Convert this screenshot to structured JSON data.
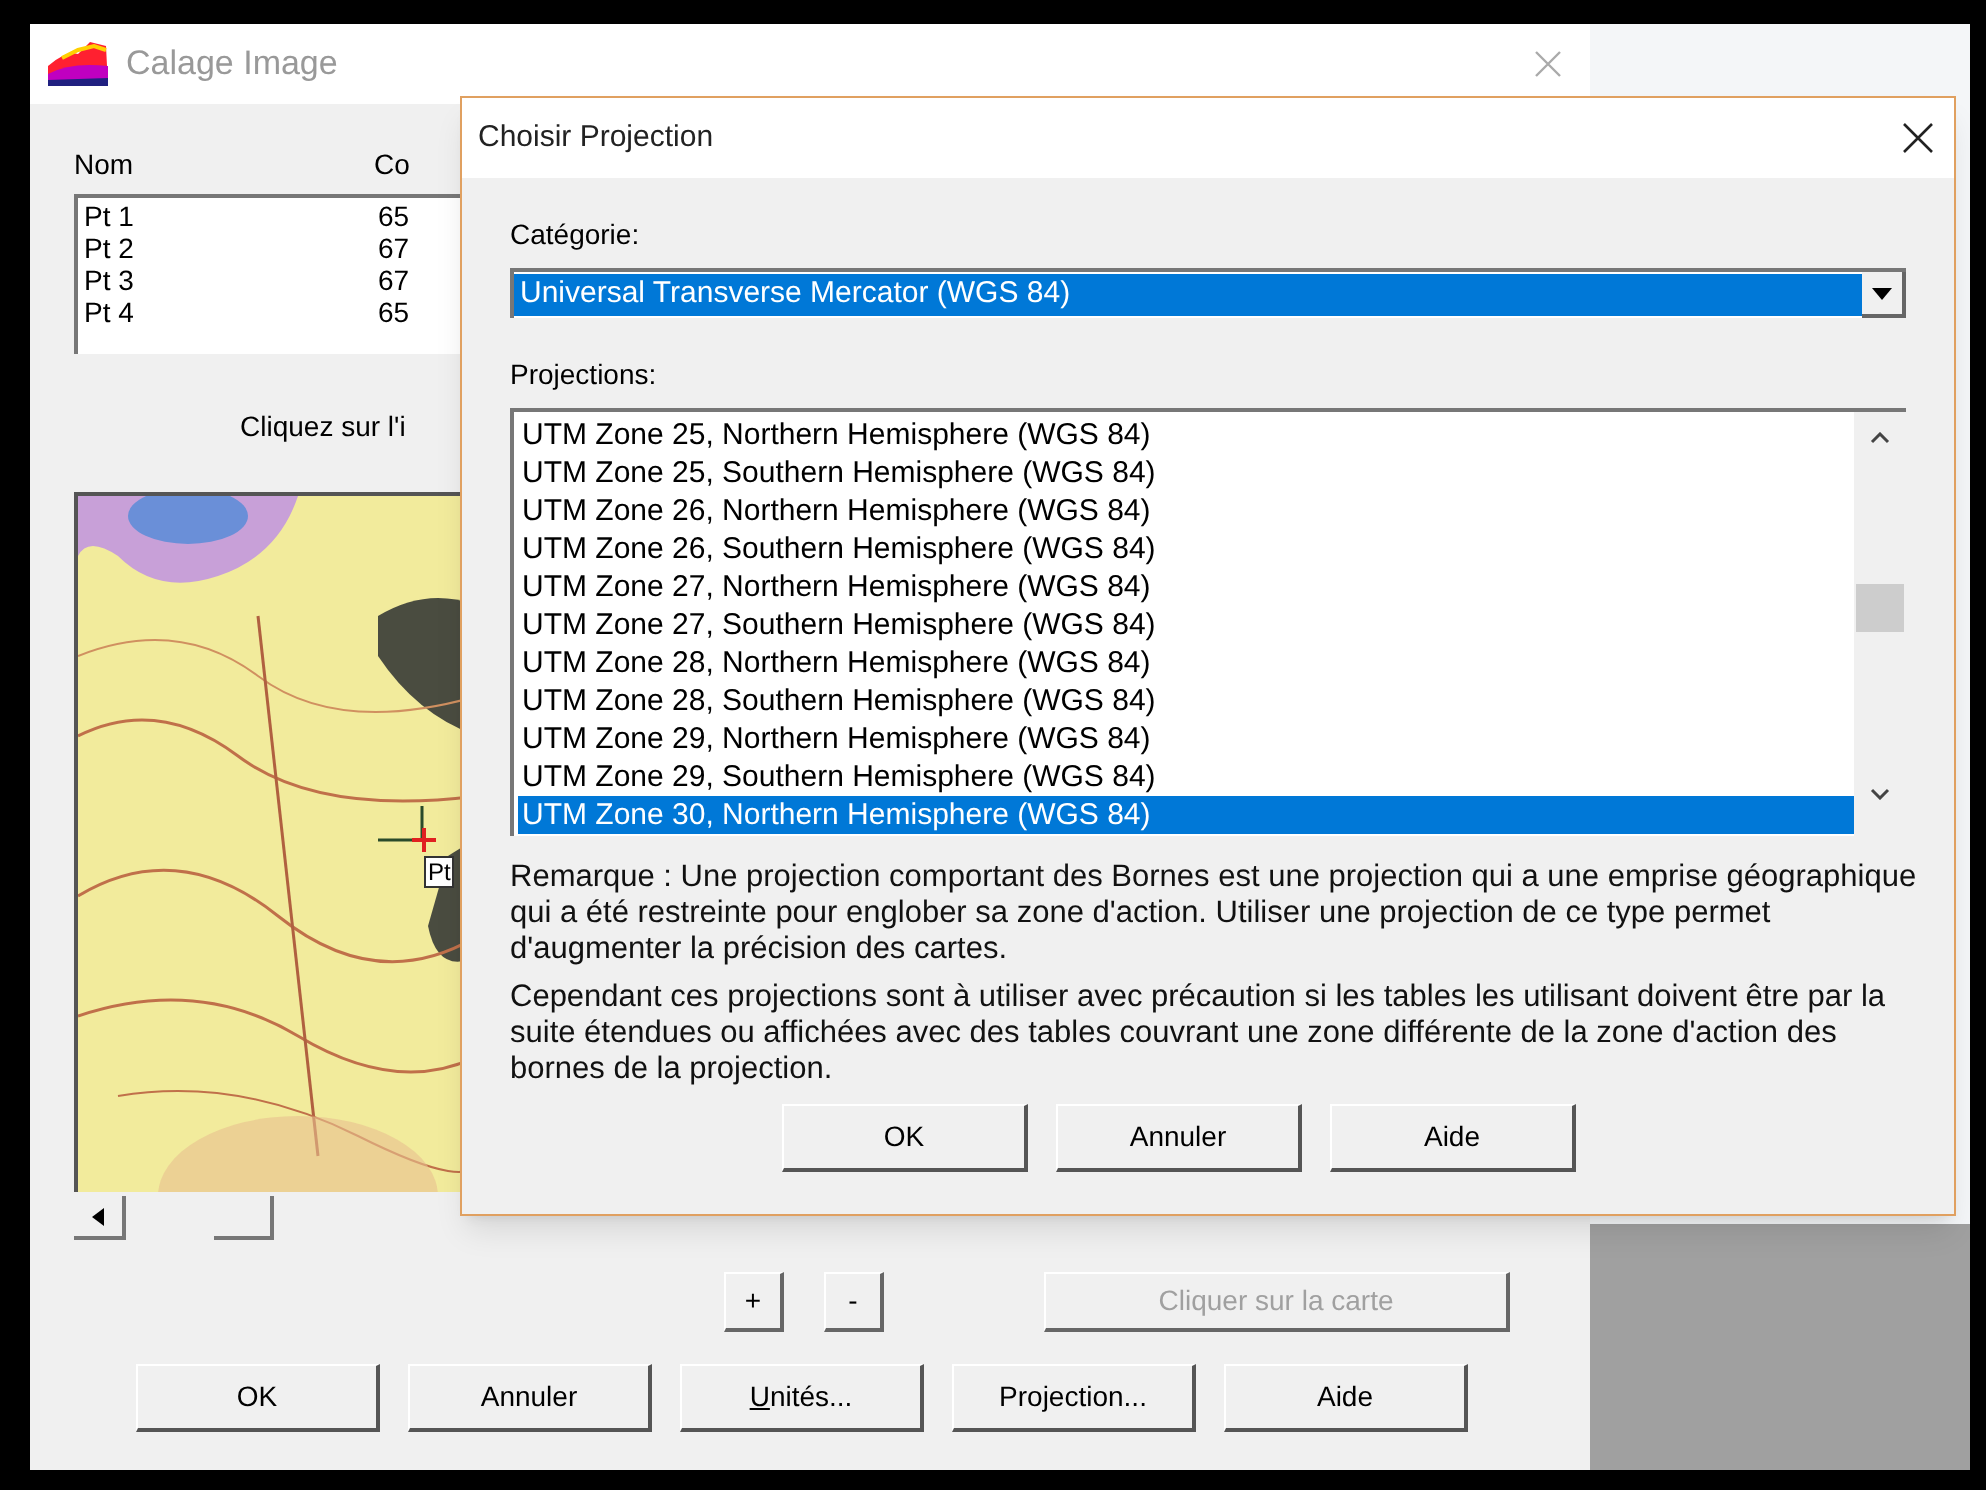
{
  "back_window": {
    "title": "Calage Image",
    "columns": [
      "Nom",
      "Co"
    ],
    "rows": [
      {
        "name": "Pt 1",
        "value": "65"
      },
      {
        "name": "Pt 2",
        "value": "67"
      },
      {
        "name": "Pt 3",
        "value": "67"
      },
      {
        "name": "Pt 4",
        "value": "65"
      }
    ],
    "instruction": "Cliquez sur l'i",
    "point_label": "Pt",
    "zoom_buttons": [
      "+",
      "-"
    ],
    "map_click_button": {
      "label": "Cliquer sur la carte",
      "disabled": true
    },
    "buttons": [
      "OK",
      "Annuler",
      "Unités...",
      "Projection...",
      "Aide"
    ]
  },
  "dialog": {
    "title": "Choisir Projection",
    "category_label": "Catégorie:",
    "category_value": "Universal Transverse Mercator (WGS 84)",
    "projections_label": "Projections:",
    "projections": [
      {
        "label": "UTM Zone 25, Northern Hemisphere (WGS 84)",
        "selected": false
      },
      {
        "label": "UTM Zone 25, Southern Hemisphere (WGS 84)",
        "selected": false
      },
      {
        "label": "UTM Zone 26, Northern Hemisphere (WGS 84)",
        "selected": false
      },
      {
        "label": "UTM Zone 26, Southern Hemisphere (WGS 84)",
        "selected": false
      },
      {
        "label": "UTM Zone 27, Northern Hemisphere (WGS 84)",
        "selected": false
      },
      {
        "label": "UTM Zone 27, Southern Hemisphere (WGS 84)",
        "selected": false
      },
      {
        "label": "UTM Zone 28, Northern Hemisphere (WGS 84)",
        "selected": false
      },
      {
        "label": "UTM Zone 28, Southern Hemisphere (WGS 84)",
        "selected": false
      },
      {
        "label": "UTM Zone 29, Northern Hemisphere (WGS 84)",
        "selected": false
      },
      {
        "label": "UTM Zone 29, Southern Hemisphere (WGS 84)",
        "selected": false
      },
      {
        "label": "UTM Zone 30, Northern Hemisphere (WGS 84)",
        "selected": true
      }
    ],
    "notes": [
      "Remarque : Une projection comportant des Bornes est une projection qui a une emprise géographique qui a été restreinte pour englober sa zone d'action. Utiliser une projection de ce type permet d'augmenter la précision des cartes.",
      "Cependant ces projections sont à utiliser avec précaution si les tables les utilisant doivent être par la suite étendues ou affichées avec des tables couvrant une zone différente de la zone d'action des bornes de la projection."
    ],
    "buttons": [
      "OK",
      "Annuler",
      "Aide"
    ]
  }
}
